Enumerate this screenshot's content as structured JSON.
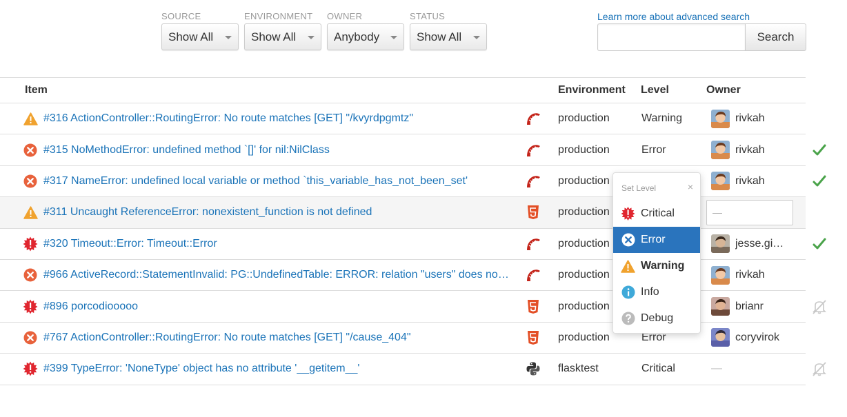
{
  "filters": [
    {
      "label": "SOURCE",
      "value": "Show All"
    },
    {
      "label": "ENVIRONMENT",
      "value": "Show All"
    },
    {
      "label": "OWNER",
      "value": "Anybody"
    },
    {
      "label": "STATUS",
      "value": "Show All"
    }
  ],
  "search": {
    "advanced_link": "Learn more about advanced search",
    "button_label": "Search",
    "placeholder": ""
  },
  "table": {
    "headers": {
      "item": "Item",
      "environment": "Environment",
      "level": "Level",
      "owner": "Owner"
    },
    "rows": [
      {
        "level_icon": "warning-icon",
        "title": "#316 ActionController::RoutingError: No route matches [GET] \"/kvyrdpgmtz\"",
        "framework_icon": "rails-icon",
        "environment": "production",
        "level": "Warning",
        "owner": "rivkah",
        "status": ""
      },
      {
        "level_icon": "error-icon",
        "title": "#315 NoMethodError: undefined method `[]' for nil:NilClass",
        "framework_icon": "rails-icon",
        "environment": "production",
        "level": "Error",
        "owner": "rivkah",
        "status": "resolved-check-icon"
      },
      {
        "level_icon": "error-icon",
        "title": "#317 NameError: undefined local variable or method `this_variable_has_not_been_set'",
        "framework_icon": "rails-icon",
        "environment": "production",
        "level": "",
        "owner": "rivkah",
        "status": "resolved-check-icon"
      },
      {
        "level_icon": "warning-icon",
        "title": "#311 Uncaught ReferenceError: nonexistent_function is not defined",
        "framework_icon": "html5-icon",
        "environment": "production",
        "level": "",
        "owner": "—",
        "status": ""
      },
      {
        "level_icon": "critical-icon",
        "title": "#320 Timeout::Error: Timeout::Error",
        "framework_icon": "rails-icon",
        "environment": "production",
        "level": "",
        "owner": "jesse.gi…",
        "status": "resolved-check-icon"
      },
      {
        "level_icon": "error-icon",
        "title": "#966 ActiveRecord::StatementInvalid: PG::UndefinedTable: ERROR: relation \"users\" does no…",
        "framework_icon": "rails-icon",
        "environment": "production",
        "level": "",
        "owner": "rivkah",
        "status": ""
      },
      {
        "level_icon": "critical-icon",
        "title": "#896 porcodiooooo",
        "framework_icon": "html5-icon",
        "environment": "production",
        "level": "",
        "owner": "brianr",
        "status": "muted-icon"
      },
      {
        "level_icon": "error-icon",
        "title": "#767 ActionController::RoutingError: No route matches [GET] \"/cause_404\"",
        "framework_icon": "html5-icon",
        "environment": "production",
        "level": "Error",
        "owner": "coryvirok",
        "status": ""
      },
      {
        "level_icon": "critical-icon",
        "title": "#399 TypeError: 'NoneType' object has no attribute '__getitem__'",
        "framework_icon": "python-icon",
        "environment": "flasktest",
        "level": "Critical",
        "owner": "—",
        "status": "muted-icon"
      }
    ]
  },
  "popover": {
    "title": "Set Level",
    "close": "×",
    "items": [
      {
        "label": "Critical",
        "icon": "critical-icon"
      },
      {
        "label": "Error",
        "icon": "error-icon"
      },
      {
        "label": "Warning",
        "icon": "warning-icon"
      },
      {
        "label": "Info",
        "icon": "info-icon"
      },
      {
        "label": "Debug",
        "icon": "debug-icon"
      }
    ]
  },
  "colors": {
    "link": "#1a73b8",
    "active": "#2a74bd",
    "error": "#e8623c",
    "warning": "#f0a22e",
    "critical": "#e0262f",
    "info": "#3fa9d9",
    "debug": "#bbbbbb",
    "resolved": "#4aa34a"
  }
}
